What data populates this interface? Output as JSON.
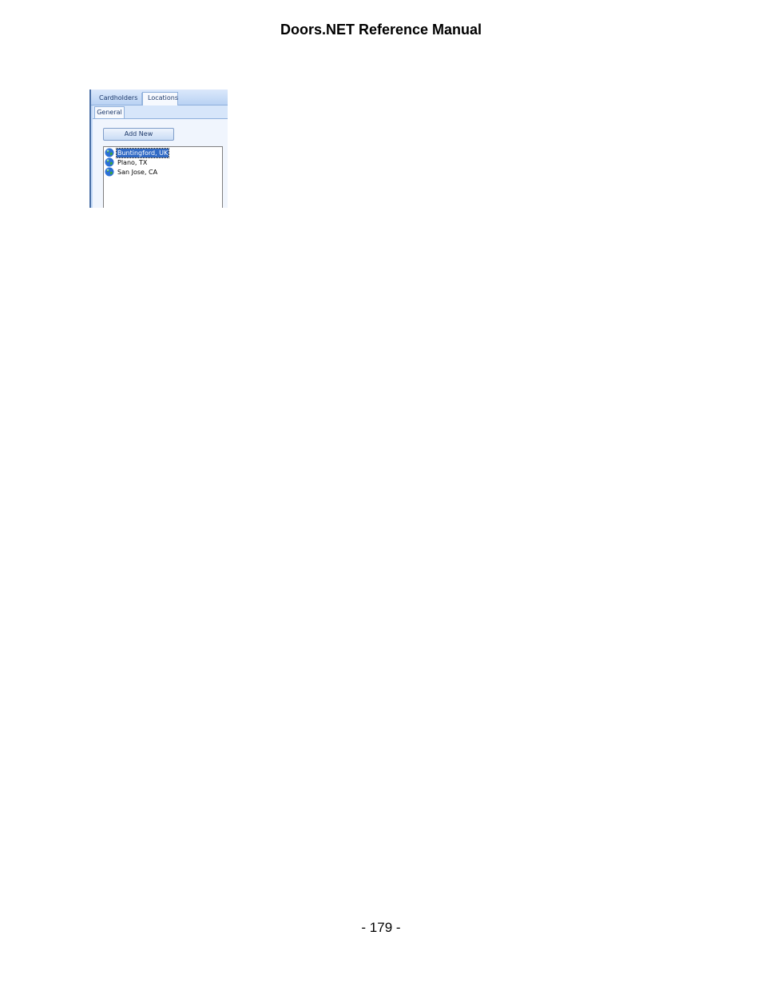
{
  "document": {
    "title": "Doors.NET Reference Manual",
    "page_number": "- 179 -"
  },
  "screenshot": {
    "tabs": [
      {
        "label": "Cardholders",
        "active": false
      },
      {
        "label": "Locations",
        "active": true
      }
    ],
    "subtab": {
      "label": "General"
    },
    "add_new_button": {
      "label": "Add New"
    },
    "locations_list": [
      {
        "label": "Buntingford, UK",
        "selected": true,
        "icon": "globe-icon"
      },
      {
        "label": "Plano, TX",
        "selected": false,
        "icon": "globe-icon"
      },
      {
        "label": "San Jose, CA",
        "selected": false,
        "icon": "globe-icon"
      }
    ],
    "colors": {
      "panel_background": "#c5dbf7",
      "selection": "#316ac5"
    }
  }
}
